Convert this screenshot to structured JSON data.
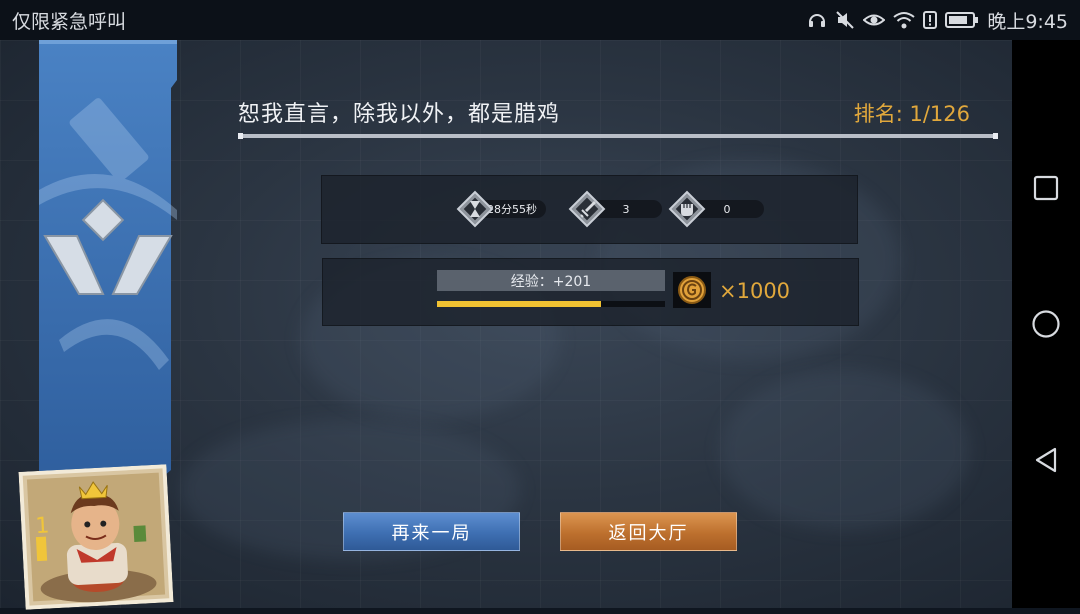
{
  "status_bar": {
    "left_text": "仅限紧急呼叫",
    "time": "晚上9:45"
  },
  "result": {
    "title": "恕我直言，除我以外，都是腊鸡",
    "rank": "排名: 1/126"
  },
  "stats": [
    {
      "icon": "hourglass-icon",
      "value": "28分55秒"
    },
    {
      "icon": "dagger-icon",
      "value": "3"
    },
    {
      "icon": "fist-icon",
      "value": "0"
    }
  ],
  "reward": {
    "exp_label": "经验：+201",
    "exp_progress": 0.72,
    "coin_icon": "gold-coin-icon",
    "coin_count": "×1000"
  },
  "buttons": {
    "play_again": "再来一局",
    "back_to_lobby": "返回大厅"
  },
  "colors": {
    "accent_gold": "#e1a83c",
    "banner_blue": "#3e72b4",
    "button_blue": "#3e6fb2",
    "button_orange": "#bd702e",
    "progress_yellow": "#f1c232"
  },
  "nav_bar": {
    "icons": [
      "recent-apps-icon",
      "home-icon",
      "back-icon"
    ]
  }
}
